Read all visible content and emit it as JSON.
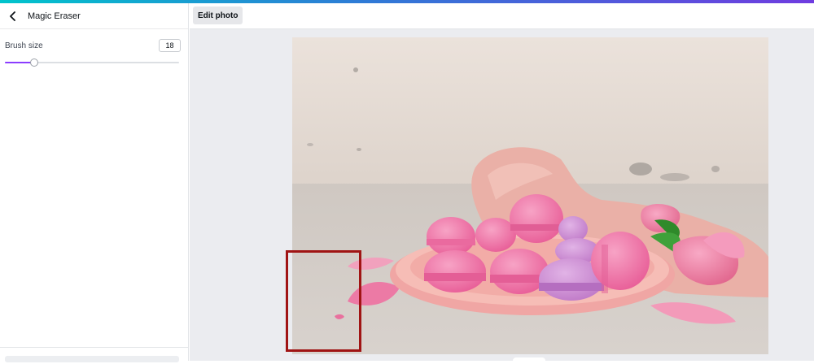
{
  "panel": {
    "title": "Magic Eraser",
    "brush_size_label": "Brush size",
    "brush_size_value": "18",
    "slider_fraction": 0.17
  },
  "toolbar": {
    "edit_photo_label": "Edit photo"
  },
  "colors": {
    "accent": "#8b3dff",
    "selection": "#a01414"
  },
  "icons": {
    "back": "chevron-left-icon"
  }
}
